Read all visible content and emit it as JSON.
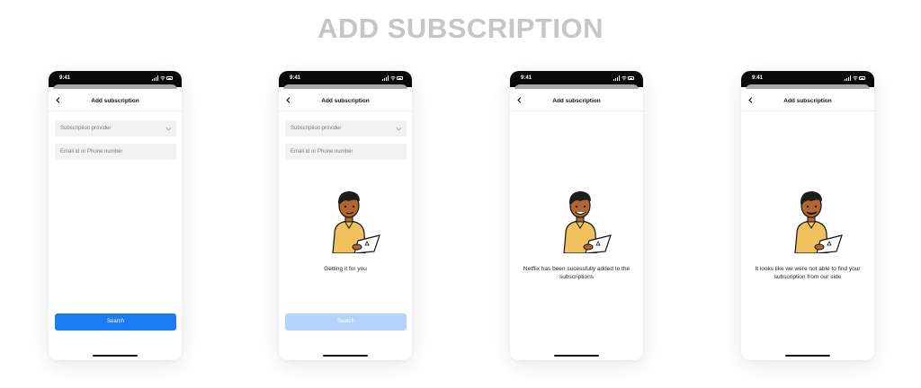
{
  "page": {
    "title": "ADD SUBSCRIPTION"
  },
  "status_bar": {
    "time": "9:41"
  },
  "colors": {
    "accent": "#1a7cf5",
    "accent_disabled": "#b3d3fb",
    "shirt": "#f0c25e",
    "skin": "#b0662f",
    "hair": "#1c1c1c"
  },
  "icons": [
    "back-chevron-icon",
    "chevron-down-icon",
    "signal-icon",
    "wifi-icon",
    "battery-icon"
  ],
  "screens": [
    {
      "nav_title": "Add subscription",
      "provider_placeholder": "Subscription provider",
      "email_placeholder": "Email id or Phone number",
      "button_label": "Search",
      "button_state": "enabled"
    },
    {
      "nav_title": "Add subscription",
      "provider_placeholder": "Subscription provider",
      "email_placeholder": "Email id or Phone number",
      "message": "Getting it for you",
      "button_label": "Search",
      "button_state": "disabled"
    },
    {
      "nav_title": "Add subscription",
      "message": "Netflix has been sucessfully added to the subscriptions"
    },
    {
      "nav_title": "Add subscription",
      "message": "It looks like we were not able to find your subscription from our side"
    }
  ]
}
